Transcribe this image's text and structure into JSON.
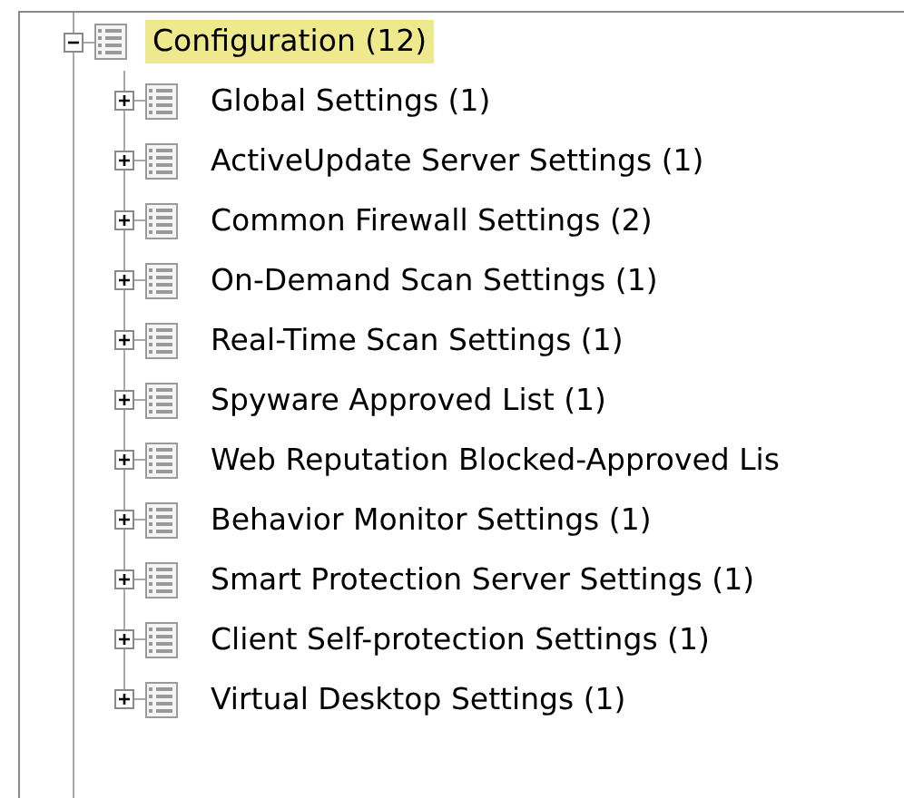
{
  "tree": {
    "label": "Configuration (12)",
    "expanded": true,
    "selected": true,
    "children": [
      {
        "label": "Global Settings (1)",
        "expanded": false,
        "selected": false
      },
      {
        "label": "ActiveUpdate Server Settings (1)",
        "expanded": false,
        "selected": false
      },
      {
        "label": "Common Firewall Settings (2)",
        "expanded": false,
        "selected": false
      },
      {
        "label": "On-Demand Scan Settings (1)",
        "expanded": false,
        "selected": false
      },
      {
        "label": "Real-Time Scan Settings (1)",
        "expanded": false,
        "selected": false
      },
      {
        "label": "Spyware Approved List (1)",
        "expanded": false,
        "selected": false
      },
      {
        "label": "Web Reputation Blocked-Approved Lis",
        "expanded": false,
        "selected": false
      },
      {
        "label": "Behavior Monitor Settings (1)",
        "expanded": false,
        "selected": false
      },
      {
        "label": "Smart Protection Server Settings (1)",
        "expanded": false,
        "selected": false
      },
      {
        "label": "Client Self-protection Settings (1)",
        "expanded": false,
        "selected": false
      },
      {
        "label": "Virtual Desktop Settings (1)",
        "expanded": false,
        "selected": false
      }
    ]
  }
}
